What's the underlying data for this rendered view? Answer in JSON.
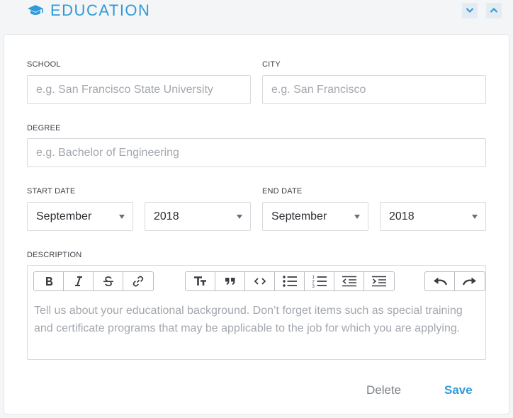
{
  "section": {
    "title": "EDUCATION",
    "icon": "graduation-cap-icon",
    "accent_color": "#2e9bd8"
  },
  "form": {
    "school": {
      "label": "SCHOOL",
      "placeholder": "e.g. San Francisco State University"
    },
    "city": {
      "label": "CITY",
      "placeholder": "e.g. San Francisco"
    },
    "degree": {
      "label": "DEGREE",
      "placeholder": "e.g. Bachelor of Engineering"
    },
    "start_date": {
      "label": "START DATE",
      "month": "September",
      "year": "2018"
    },
    "end_date": {
      "label": "END DATE",
      "month": "September",
      "year": "2018"
    },
    "description": {
      "label": "DESCRIPTION",
      "placeholder": "Tell us about your educational background. Don’t forget items such as special training and certificate programs that may be applicable to the job for which you are applying."
    }
  },
  "actions": {
    "delete_label": "Delete",
    "save_label": "Save"
  }
}
